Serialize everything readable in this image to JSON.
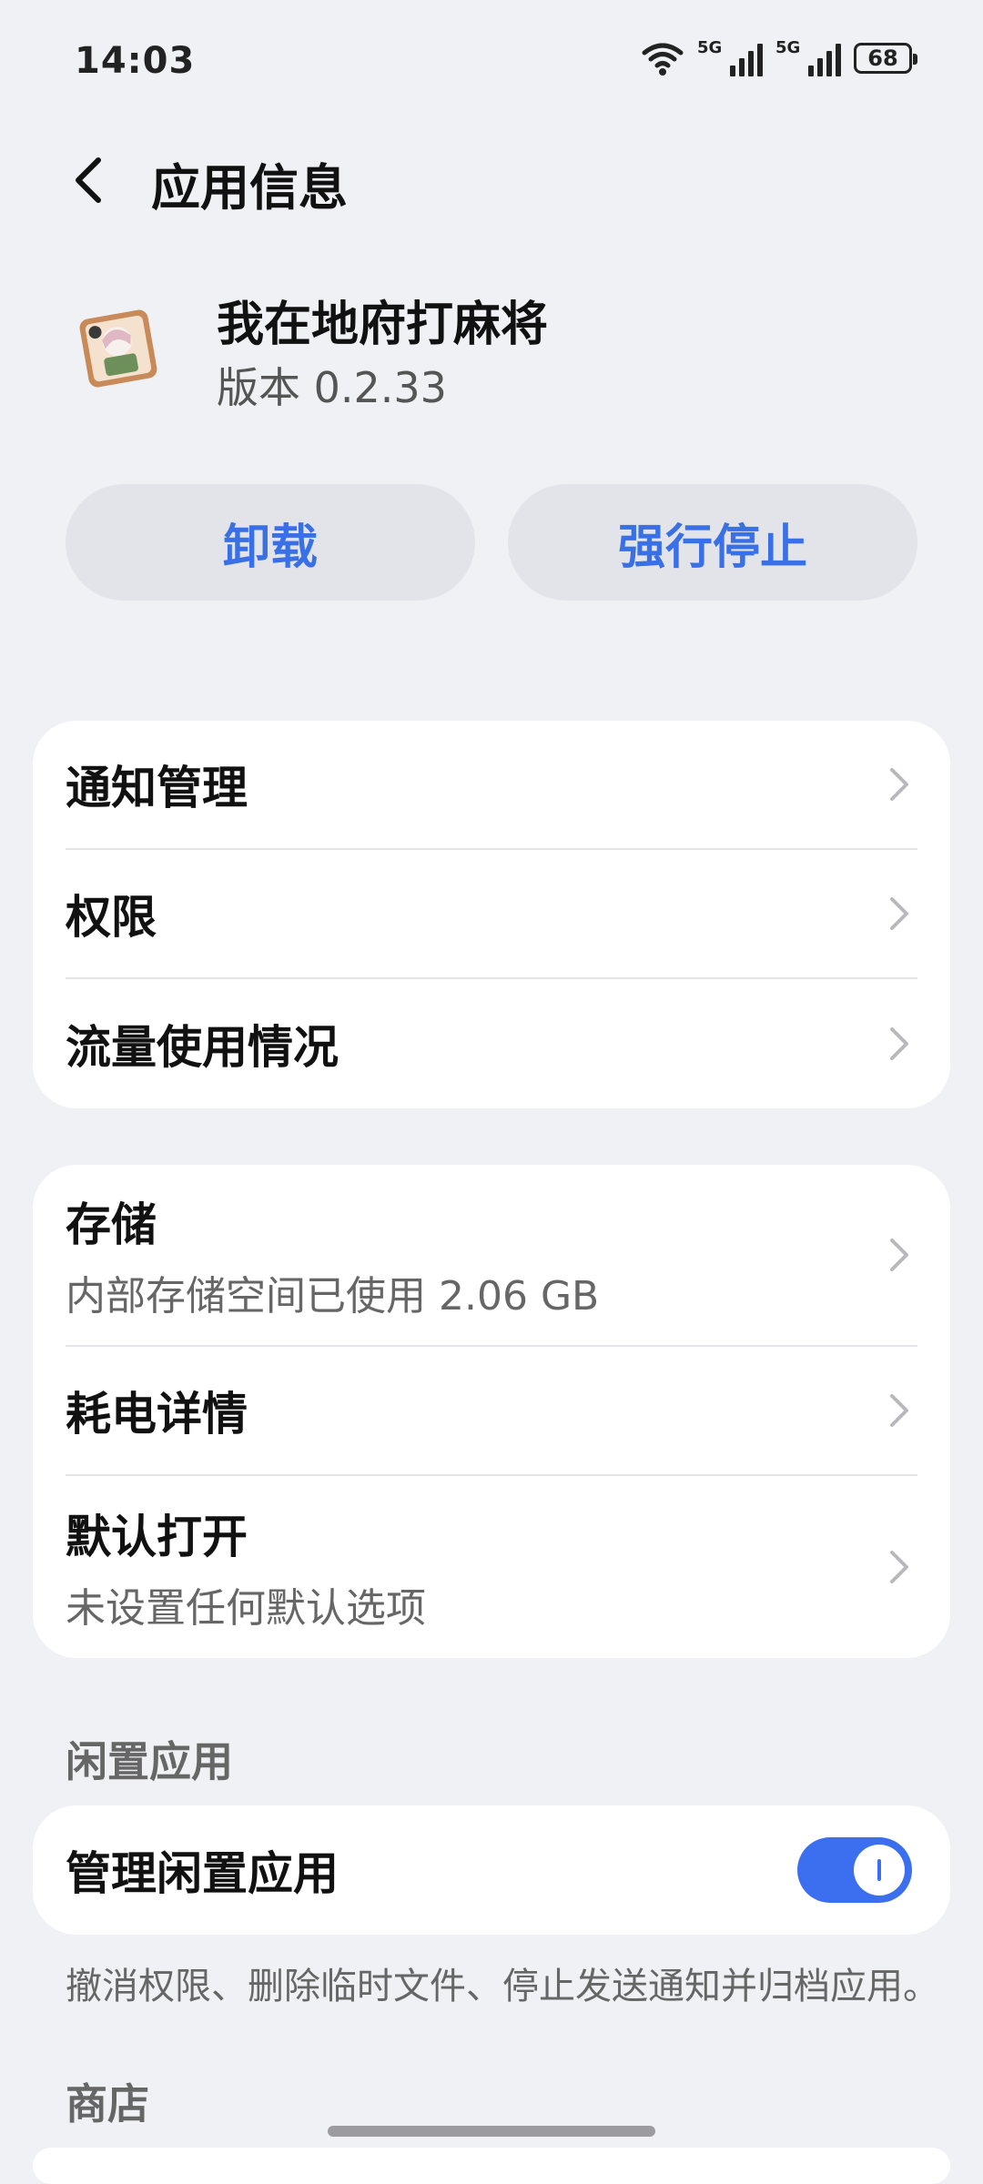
{
  "status_bar": {
    "time": "14:03",
    "sim1_tag": "5G",
    "sim2_tag": "5G",
    "battery": "68"
  },
  "header": {
    "title": "应用信息"
  },
  "app": {
    "name": "我在地府打麻将",
    "version": "版本 0.2.33",
    "icon": "mahjong-game-icon"
  },
  "actions": {
    "uninstall": "卸载",
    "force_stop": "强行停止"
  },
  "card1": {
    "items": [
      {
        "label": "通知管理"
      },
      {
        "label": "权限"
      },
      {
        "label": "流量使用情况"
      }
    ]
  },
  "card2": {
    "items": [
      {
        "label": "存储",
        "sub": "内部存储空间已使用 2.06 GB"
      },
      {
        "label": "耗电详情"
      },
      {
        "label": "默认打开",
        "sub": "未设置任何默认选项"
      }
    ]
  },
  "idle": {
    "section_label": "闲置应用",
    "toggle_label": "管理闲置应用",
    "toggle_on": true,
    "note": "撤消权限、删除临时文件、停止发送通知并归档应用。"
  },
  "store": {
    "section_label": "商店"
  },
  "colors": {
    "accent": "#3a70e6",
    "background": "#f0f1f5",
    "card": "#ffffff"
  }
}
